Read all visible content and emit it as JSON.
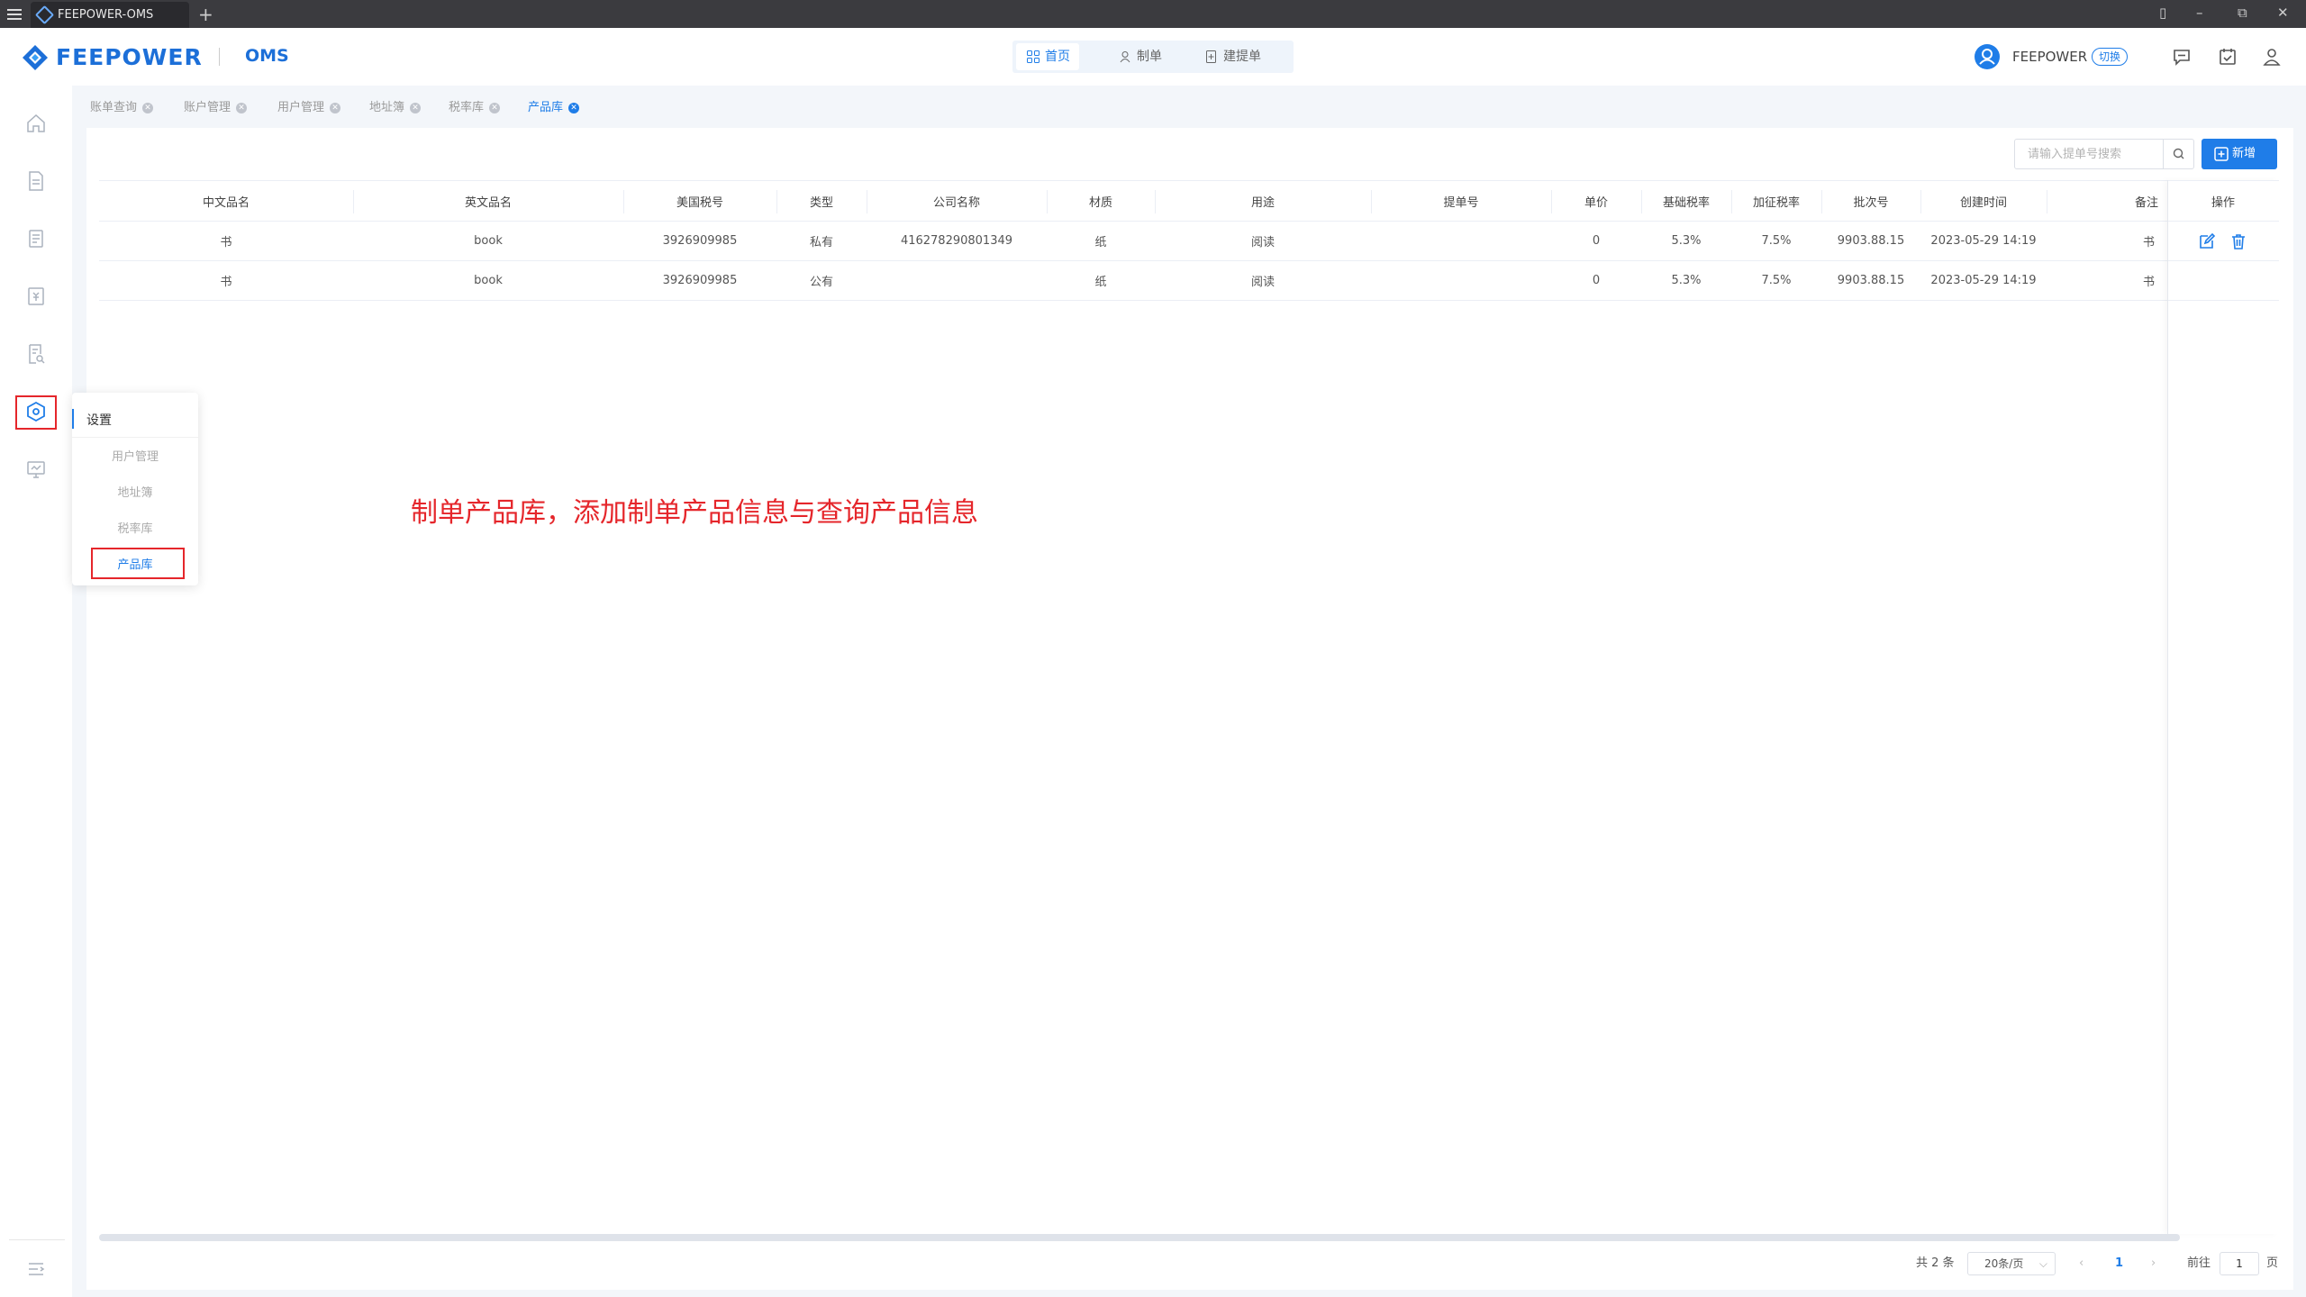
{
  "window": {
    "tab_title": "FEEPOWER-OMS",
    "new_tab": "+"
  },
  "header": {
    "logo_text": "FEEPOWER",
    "app_name": "OMS",
    "nav": [
      {
        "label": "首页",
        "icon": "grid-icon",
        "active": true
      },
      {
        "label": "制单",
        "icon": "user-doc-icon",
        "active": false
      },
      {
        "label": "建提单",
        "icon": "doc-plus-icon",
        "active": false
      }
    ],
    "user_name": "FEEPOWER",
    "switch_label": "切换"
  },
  "tabs": [
    {
      "label": "账单查询",
      "active": false
    },
    {
      "label": "账户管理",
      "active": false
    },
    {
      "label": "用户管理",
      "active": false
    },
    {
      "label": "地址簿",
      "active": false
    },
    {
      "label": "税率库",
      "active": false
    },
    {
      "label": "产品库",
      "active": true
    }
  ],
  "toolbar": {
    "search_placeholder": "请输入提单号搜索",
    "add_label": "新增"
  },
  "table": {
    "columns": [
      "中文品名",
      "英文品名",
      "美国税号",
      "类型",
      "公司名称",
      "材质",
      "用途",
      "提单号",
      "单价",
      "基础税率",
      "加征税率",
      "批次号",
      "创建时间",
      "备注",
      "操作"
    ],
    "rows": [
      {
        "cn_name": "书",
        "en_name": "book",
        "hs_code": "3926909985",
        "type": "私有",
        "company": "416278290801349",
        "material": "纸",
        "usage": "阅读",
        "bill_no": "",
        "price": "0",
        "base_rate": "5.3%",
        "extra_rate": "7.5%",
        "batch": "9903.88.15",
        "created": "2023-05-29 14:19",
        "remark": "书",
        "has_ops": true
      },
      {
        "cn_name": "书",
        "en_name": "book",
        "hs_code": "3926909985",
        "type": "公有",
        "company": "",
        "material": "纸",
        "usage": "阅读",
        "bill_no": "",
        "price": "0",
        "base_rate": "5.3%",
        "extra_rate": "7.5%",
        "batch": "9903.88.15",
        "created": "2023-05-29 14:19",
        "remark": "书",
        "has_ops": false
      }
    ]
  },
  "pagination": {
    "total": "共 2 条",
    "page_size": "20条/页",
    "current_page": "1",
    "goto_label": "前往",
    "goto_value": "1",
    "page_unit": "页"
  },
  "settings_menu": {
    "title": "设置",
    "items": [
      {
        "label": "用户管理",
        "active": false
      },
      {
        "label": "地址簿",
        "active": false
      },
      {
        "label": "税率库",
        "active": false
      },
      {
        "label": "产品库",
        "active": true
      }
    ]
  },
  "annotation": "制单产品库，添加制单产品信息与查询产品信息",
  "colors": {
    "primary": "#1f7de8",
    "highlight": "#e5262b",
    "titlebar": "#3b3b3f"
  }
}
